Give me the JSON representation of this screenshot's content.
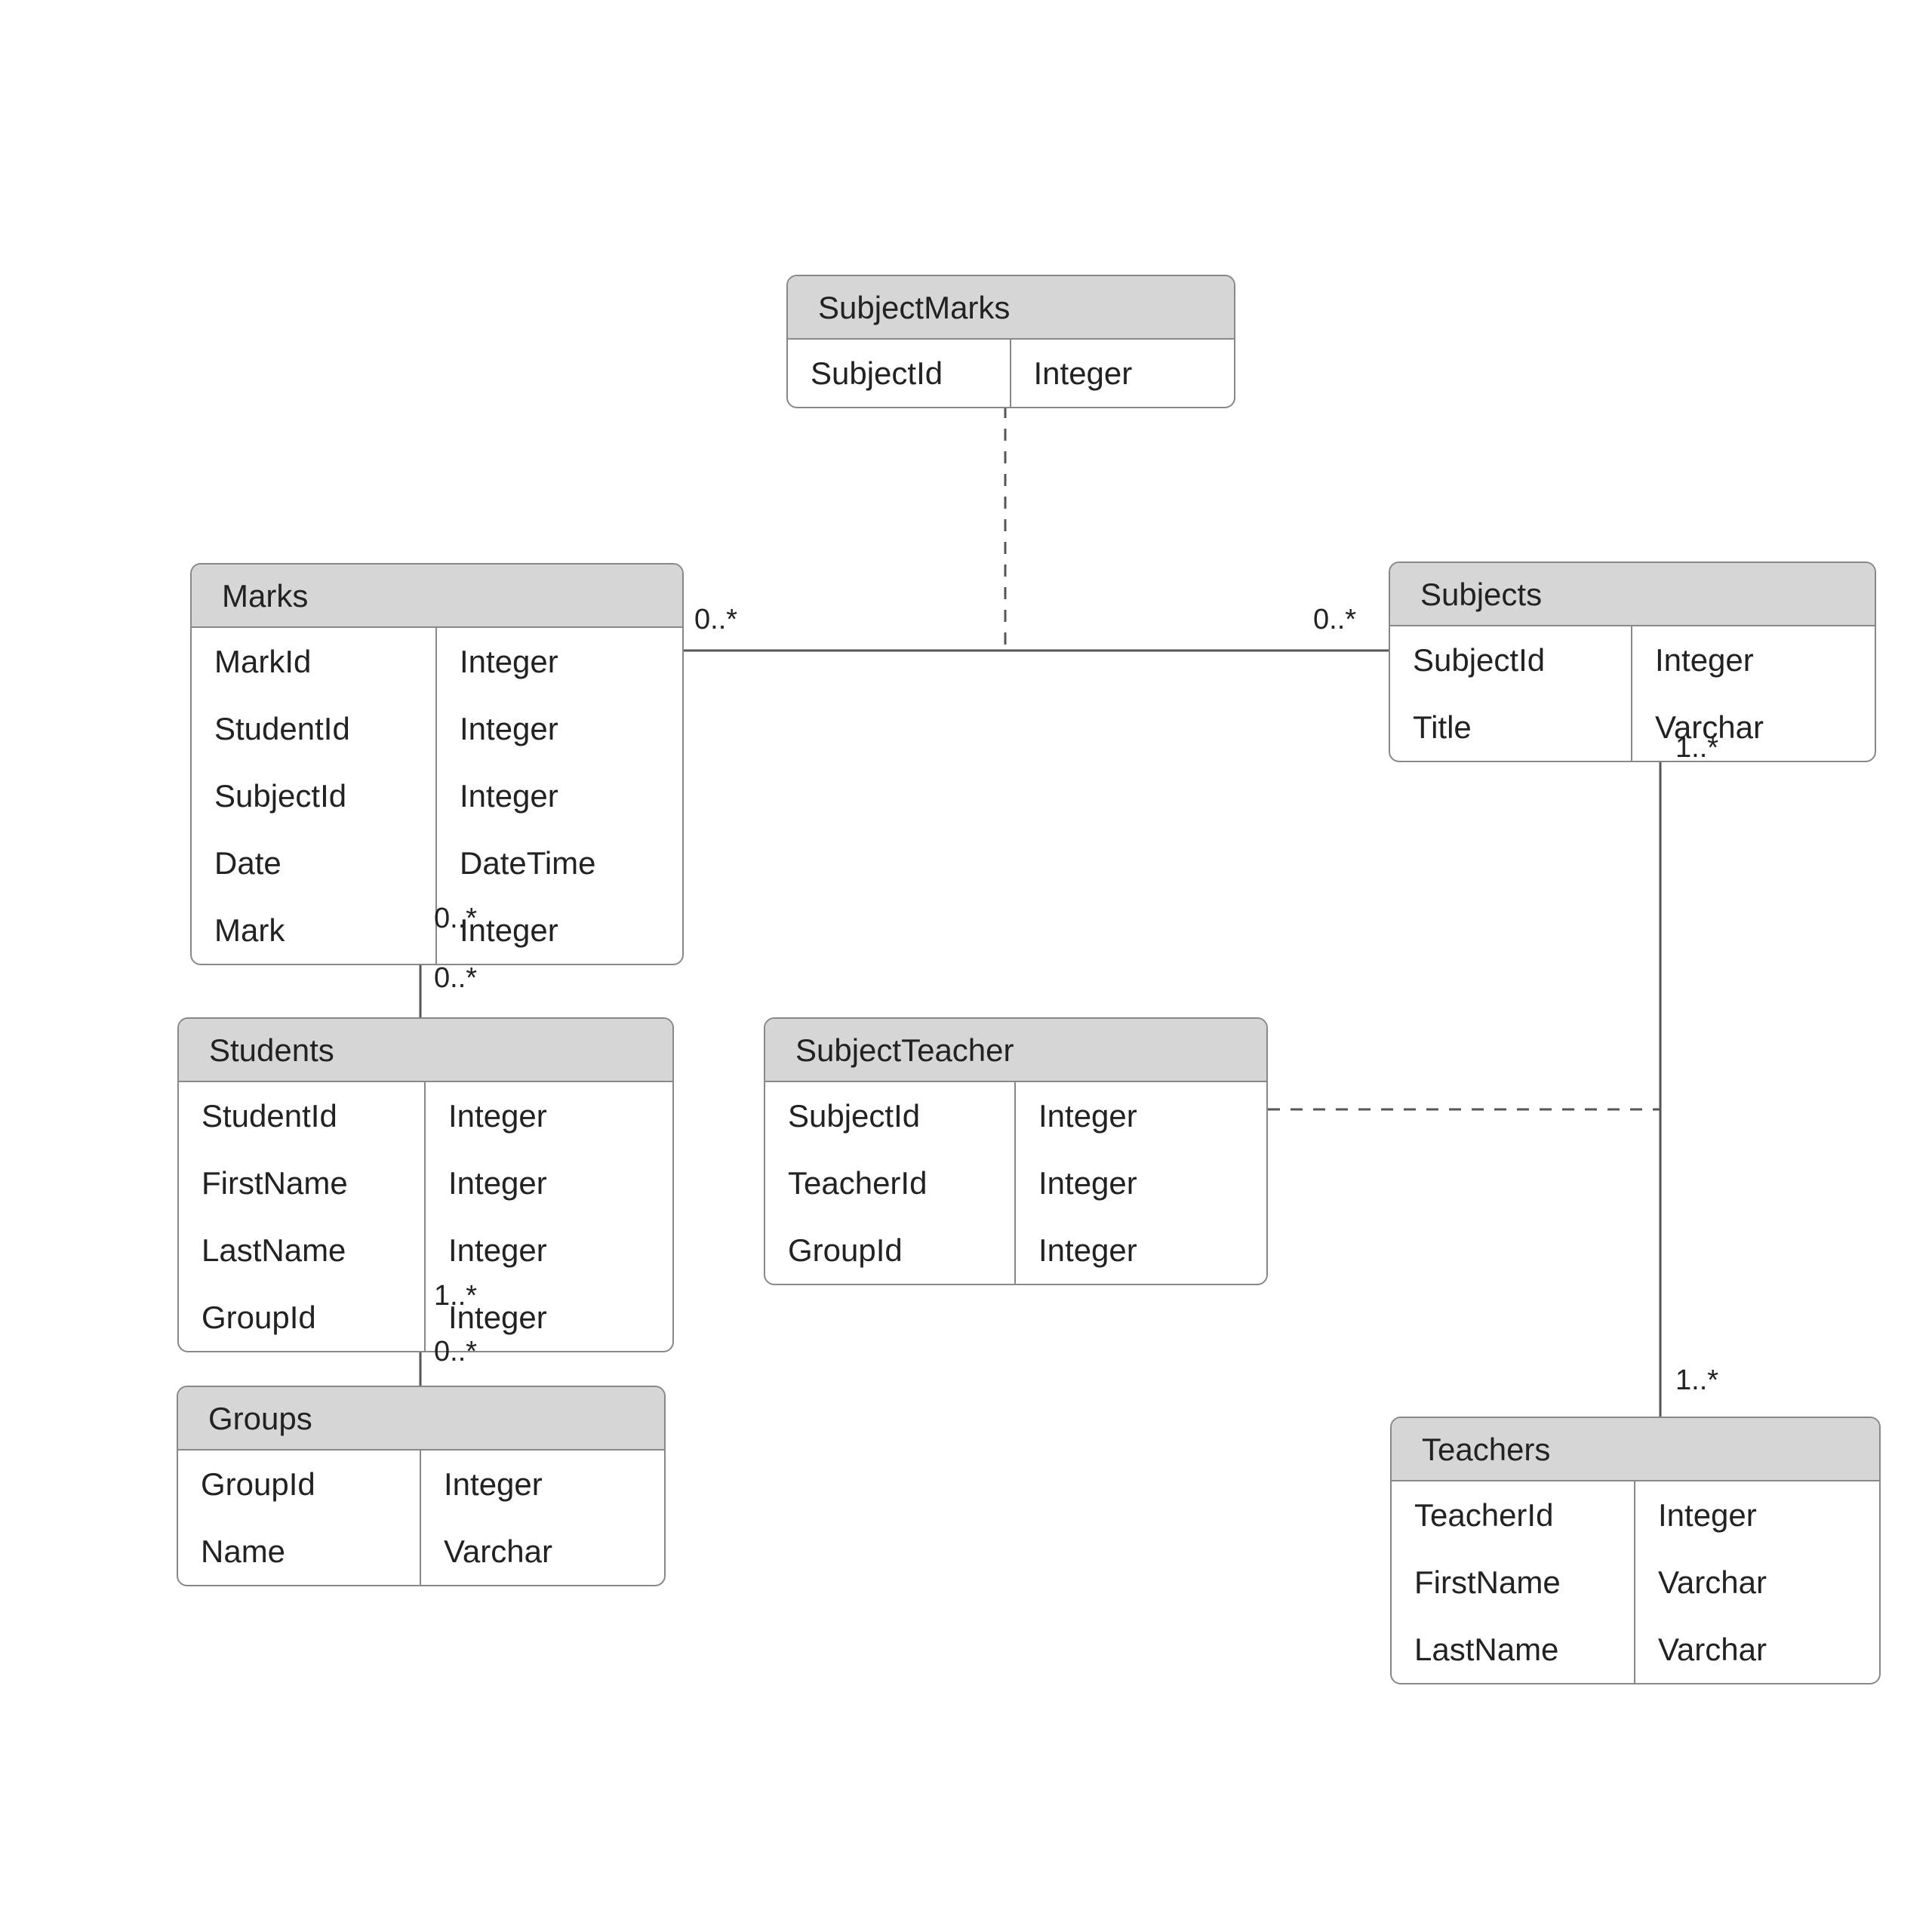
{
  "entities": {
    "subjectMarks": {
      "title": "SubjectMarks",
      "attrs": [
        {
          "name": "SubjectId",
          "type": "Integer"
        }
      ]
    },
    "marks": {
      "title": "Marks",
      "attrs": [
        {
          "name": "MarkId",
          "type": "Integer"
        },
        {
          "name": "StudentId",
          "type": "Integer"
        },
        {
          "name": "SubjectId",
          "type": "Integer"
        },
        {
          "name": "Date",
          "type": "DateTime"
        },
        {
          "name": "Mark",
          "type": "Integer"
        }
      ]
    },
    "subjects": {
      "title": "Subjects",
      "attrs": [
        {
          "name": "SubjectId",
          "type": "Integer"
        },
        {
          "name": "Title",
          "type": "Varchar"
        }
      ]
    },
    "students": {
      "title": "Students",
      "attrs": [
        {
          "name": "StudentId",
          "type": "Integer"
        },
        {
          "name": "FirstName",
          "type": "Integer"
        },
        {
          "name": "LastName",
          "type": "Integer"
        },
        {
          "name": "GroupId",
          "type": "Integer"
        }
      ]
    },
    "subjectTeacher": {
      "title": "SubjectTeacher",
      "attrs": [
        {
          "name": "SubjectId",
          "type": "Integer"
        },
        {
          "name": "TeacherId",
          "type": "Integer"
        },
        {
          "name": "GroupId",
          "type": "Integer"
        }
      ]
    },
    "groups": {
      "title": "Groups",
      "attrs": [
        {
          "name": "GroupId",
          "type": "Integer"
        },
        {
          "name": "Name",
          "type": "Varchar"
        }
      ]
    },
    "teachers": {
      "title": "Teachers",
      "attrs": [
        {
          "name": "TeacherId",
          "type": "Integer"
        },
        {
          "name": "FirstName",
          "type": "Varchar"
        },
        {
          "name": "LastName",
          "type": "Varchar"
        }
      ]
    }
  },
  "cardinalities": {
    "marksSubjects_left": "0..*",
    "marksSubjects_right": "0..*",
    "marksStudents_top": "0..*",
    "marksStudents_bottom": "0..*",
    "studentsGroups_top": "1..*",
    "studentsGroups_bottom": "0..*",
    "subjectsTeachers_top": "1..*",
    "subjectsTeachers_bottom": "1..*"
  }
}
